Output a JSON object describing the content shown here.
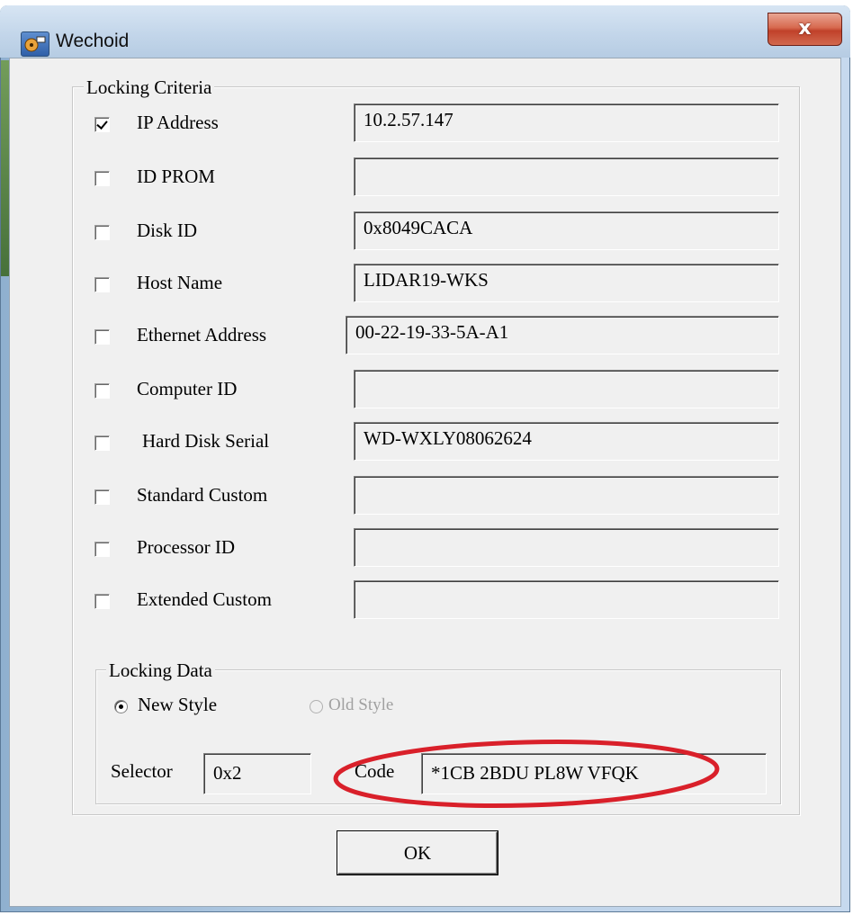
{
  "window": {
    "title": "Wechoid",
    "close_glyph": "x"
  },
  "locking_criteria": {
    "label": "Locking Criteria",
    "rows": [
      {
        "label": "IP Address",
        "checked": true,
        "value": "10.2.57.147"
      },
      {
        "label": "ID PROM",
        "checked": false,
        "value": ""
      },
      {
        "label": "Disk ID",
        "checked": false,
        "value": "0x8049CACA"
      },
      {
        "label": "Host Name",
        "checked": false,
        "value": "LIDAR19-WKS"
      },
      {
        "label": "Ethernet Address",
        "checked": false,
        "value": "00-22-19-33-5A-A1"
      },
      {
        "label": "Computer ID",
        "checked": false,
        "value": ""
      },
      {
        "label": "Hard Disk Serial",
        "checked": false,
        "value": "WD-WXLY08062624"
      },
      {
        "label": "Standard Custom",
        "checked": false,
        "value": ""
      },
      {
        "label": "Processor ID",
        "checked": false,
        "value": ""
      },
      {
        "label": "Extended Custom",
        "checked": false,
        "value": ""
      }
    ]
  },
  "locking_data": {
    "label": "Locking Data",
    "new_style_label": "New Style",
    "new_style_selected": true,
    "old_style_label": "Old Style",
    "old_style_enabled": false,
    "selector_label": "Selector",
    "selector_value": "0x2",
    "code_label": "Code",
    "code_value": "*1CB 2BDU PL8W VFQK"
  },
  "ok_label": "OK",
  "colors": {
    "highlight": "#d9202a",
    "titlebar": "#c3d6ea",
    "close": "#c0412a"
  }
}
